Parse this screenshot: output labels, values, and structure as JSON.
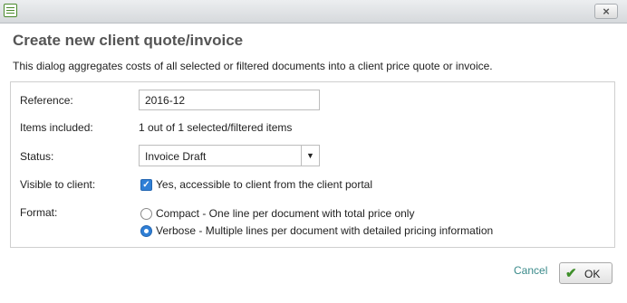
{
  "window": {
    "close_label": "×",
    "app_icon": "list-window-icon"
  },
  "dialog": {
    "title": "Create new client quote/invoice",
    "description": "This dialog aggregates costs of all selected or filtered documents into a client price quote or invoice."
  },
  "form": {
    "reference": {
      "label": "Reference:",
      "value": "2016-12"
    },
    "items": {
      "label": "Items included:",
      "value": "1 out of 1 selected/filtered items"
    },
    "status": {
      "label": "Status:",
      "value": "Invoice Draft",
      "arrow": "▼"
    },
    "visible": {
      "label": "Visible to client:",
      "checked": true,
      "check_mark": "✓",
      "option_label": "Yes, accessible to client from the client portal"
    },
    "format": {
      "label": "Format:",
      "options": [
        {
          "label": "Compact - One line per document with total price only",
          "selected": false
        },
        {
          "label": "Verbose - Multiple lines per document with detailed pricing information",
          "selected": true
        }
      ]
    }
  },
  "actions": {
    "cancel_label": "Cancel",
    "ok_label": "OK",
    "ok_icon": "✔"
  },
  "colors": {
    "accent": "#2f7fd6",
    "link": "#3a8a8a",
    "ok_check": "#3f8f2b"
  }
}
